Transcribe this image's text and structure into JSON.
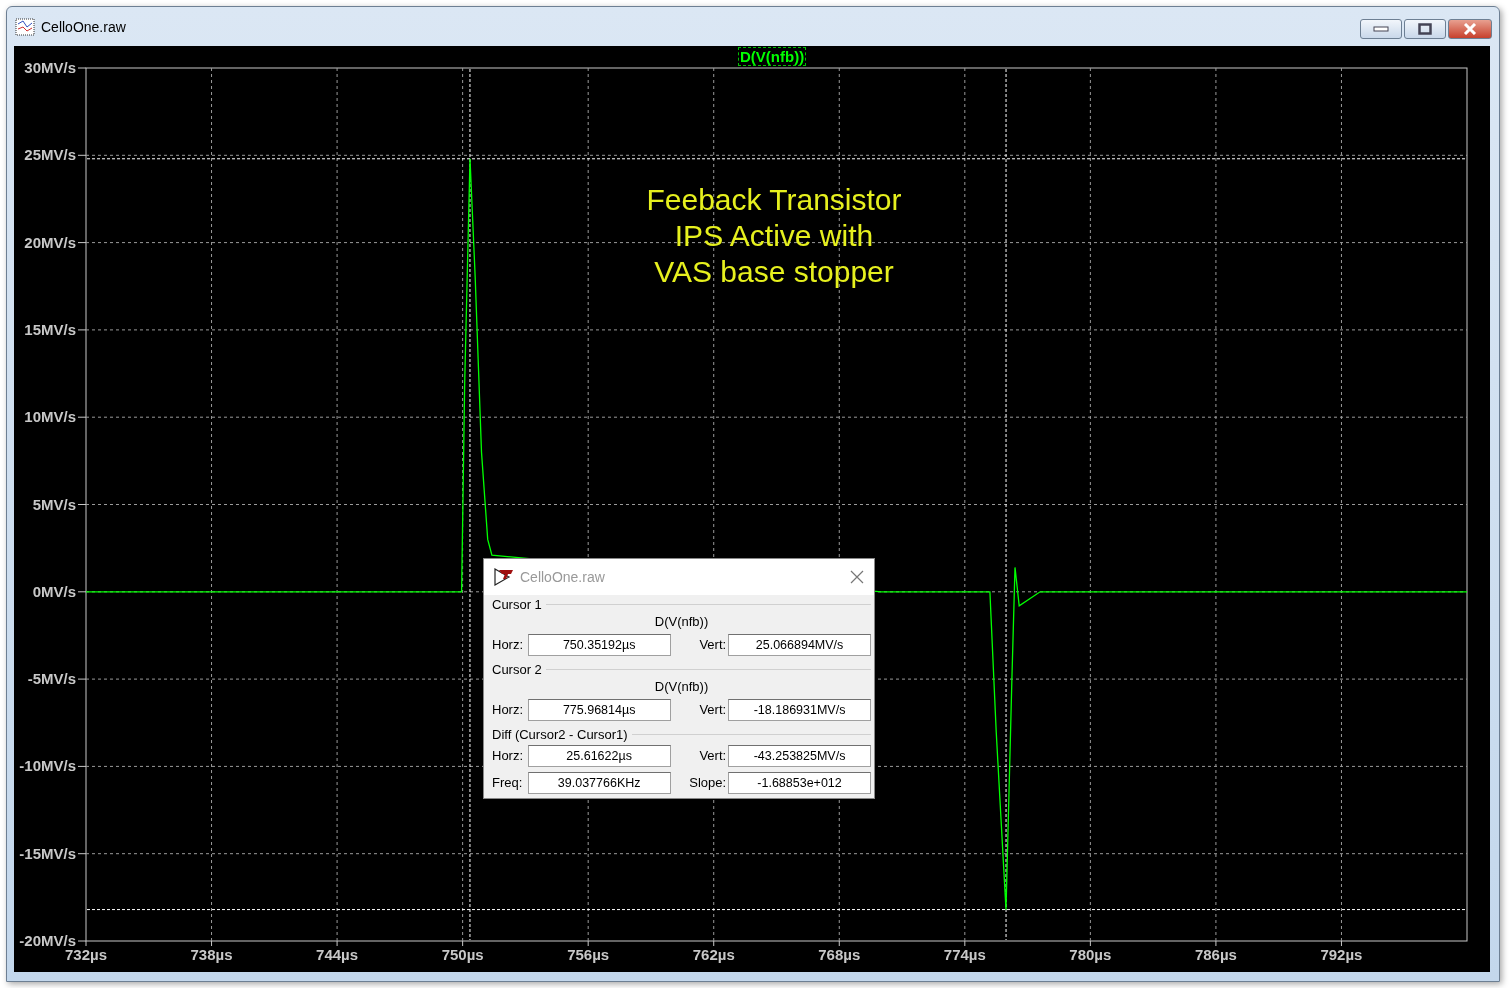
{
  "window": {
    "title": "CelloOne.raw"
  },
  "plot": {
    "note_lines": [
      "Feeback Transistor",
      "IPS Active with",
      "VAS base stopper"
    ],
    "chart_data": {
      "type": "line",
      "grid": true,
      "xlim": [
        732,
        798
      ],
      "ylim": [
        -20,
        30
      ],
      "xticks": [
        {
          "value": 732,
          "label": "732µs"
        },
        {
          "value": 738,
          "label": "738µs"
        },
        {
          "value": 744,
          "label": "744µs"
        },
        {
          "value": 750,
          "label": "750µs"
        },
        {
          "value": 756,
          "label": "756µs"
        },
        {
          "value": 762,
          "label": "762µs"
        },
        {
          "value": 768,
          "label": "768µs"
        },
        {
          "value": 774,
          "label": "774µs"
        },
        {
          "value": 780,
          "label": "780µs"
        },
        {
          "value": 786,
          "label": "786µs"
        },
        {
          "value": 792,
          "label": "792µs"
        }
      ],
      "yticks": [
        {
          "value": 30,
          "label": "30MV/s"
        },
        {
          "value": 25,
          "label": "25MV/s"
        },
        {
          "value": 20,
          "label": "20MV/s"
        },
        {
          "value": 15,
          "label": "15MV/s"
        },
        {
          "value": 10,
          "label": "10MV/s"
        },
        {
          "value": 5,
          "label": "5MV/s"
        },
        {
          "value": 0,
          "label": "0MV/s"
        },
        {
          "value": -5,
          "label": "-5MV/s"
        },
        {
          "value": -10,
          "label": "-10MV/s"
        },
        {
          "value": -15,
          "label": "-15MV/s"
        },
        {
          "value": -20,
          "label": "-20MV/s"
        }
      ],
      "x": [
        732,
        749.95,
        750.1,
        750.35,
        750.6,
        750.9,
        751.2,
        751.4,
        770,
        775.2,
        775.5,
        775.97,
        776.25,
        776.4,
        776.6,
        777.6,
        798
      ],
      "series": [
        {
          "name": "D(V(nfb))",
          "color": "#00ff00",
          "values": [
            0,
            0,
            12,
            24.8,
            18,
            8,
            3,
            2.1,
            0,
            0,
            -8,
            -18.2,
            -5,
            1.4,
            -0.8,
            0,
            0
          ]
        }
      ]
    }
  },
  "cursor_dialog": {
    "title": "CelloOne.raw",
    "sections": [
      {
        "title": "Cursor 1",
        "trace": "D(V(nfb))",
        "rows": [
          [
            {
              "label": "Horz:",
              "value": "750.35192µs"
            },
            {
              "label": "Vert:",
              "value": "25.066894MV/s"
            }
          ]
        ]
      },
      {
        "title": "Cursor 2",
        "trace": "D(V(nfb))",
        "rows": [
          [
            {
              "label": "Horz:",
              "value": "775.96814µs"
            },
            {
              "label": "Vert:",
              "value": "-18.186931MV/s"
            }
          ]
        ]
      },
      {
        "title": "Diff (Cursor2 - Cursor1)",
        "rows": [
          [
            {
              "label": "Horz:",
              "value": "25.61622µs"
            },
            {
              "label": "Vert:",
              "value": "-43.253825MV/s"
            }
          ],
          [
            {
              "label": "Freq:",
              "value": "39.037766KHz"
            },
            {
              "label": "Slope:",
              "value": "-1.68853e+012"
            }
          ]
        ]
      }
    ]
  }
}
